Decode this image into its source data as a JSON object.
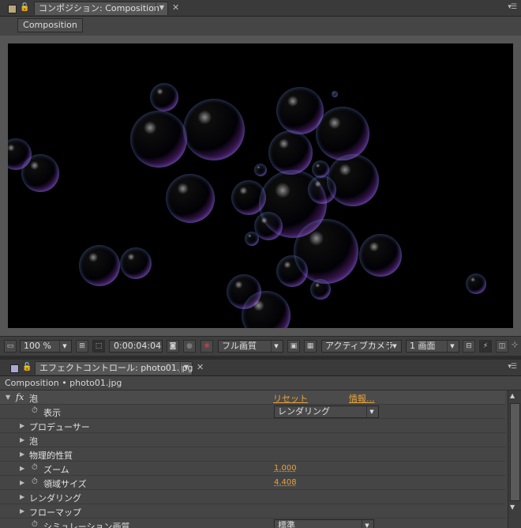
{
  "composition_panel": {
    "tab_label": "コンポジション: Composition",
    "sub_tab_label": "Composition",
    "toolbar": {
      "zoom": "100 %",
      "timecode": "0:00:04:04",
      "resolution": "フル画質",
      "camera": "アクティブカメラ",
      "views": "1 画面"
    }
  },
  "effect_panel": {
    "tab_label": "エフェクトコントロール: photo01.jpg",
    "breadcrumb": "Composition • photo01.jpg",
    "effect": {
      "fx_label": "fx",
      "name": "泡",
      "reset_label": "リセット",
      "info_label": "情報..."
    },
    "rows": [
      {
        "label": "表示",
        "dropdown": "レンダリング"
      },
      {
        "label": "プロデューサー"
      },
      {
        "label": "泡"
      },
      {
        "label": "物理的性質"
      },
      {
        "label": "ズーム",
        "value": "1.000"
      },
      {
        "label": "領域サイズ",
        "value": "4.408"
      },
      {
        "label": "レンダリング"
      },
      {
        "label": "フローマップ"
      },
      {
        "label": "シミュレーション画質",
        "dropdown": "標準"
      }
    ]
  },
  "colors": {
    "panel_bg": "#454545",
    "accent_orange": "#e8a33c",
    "viewer_bg": "#000000"
  }
}
